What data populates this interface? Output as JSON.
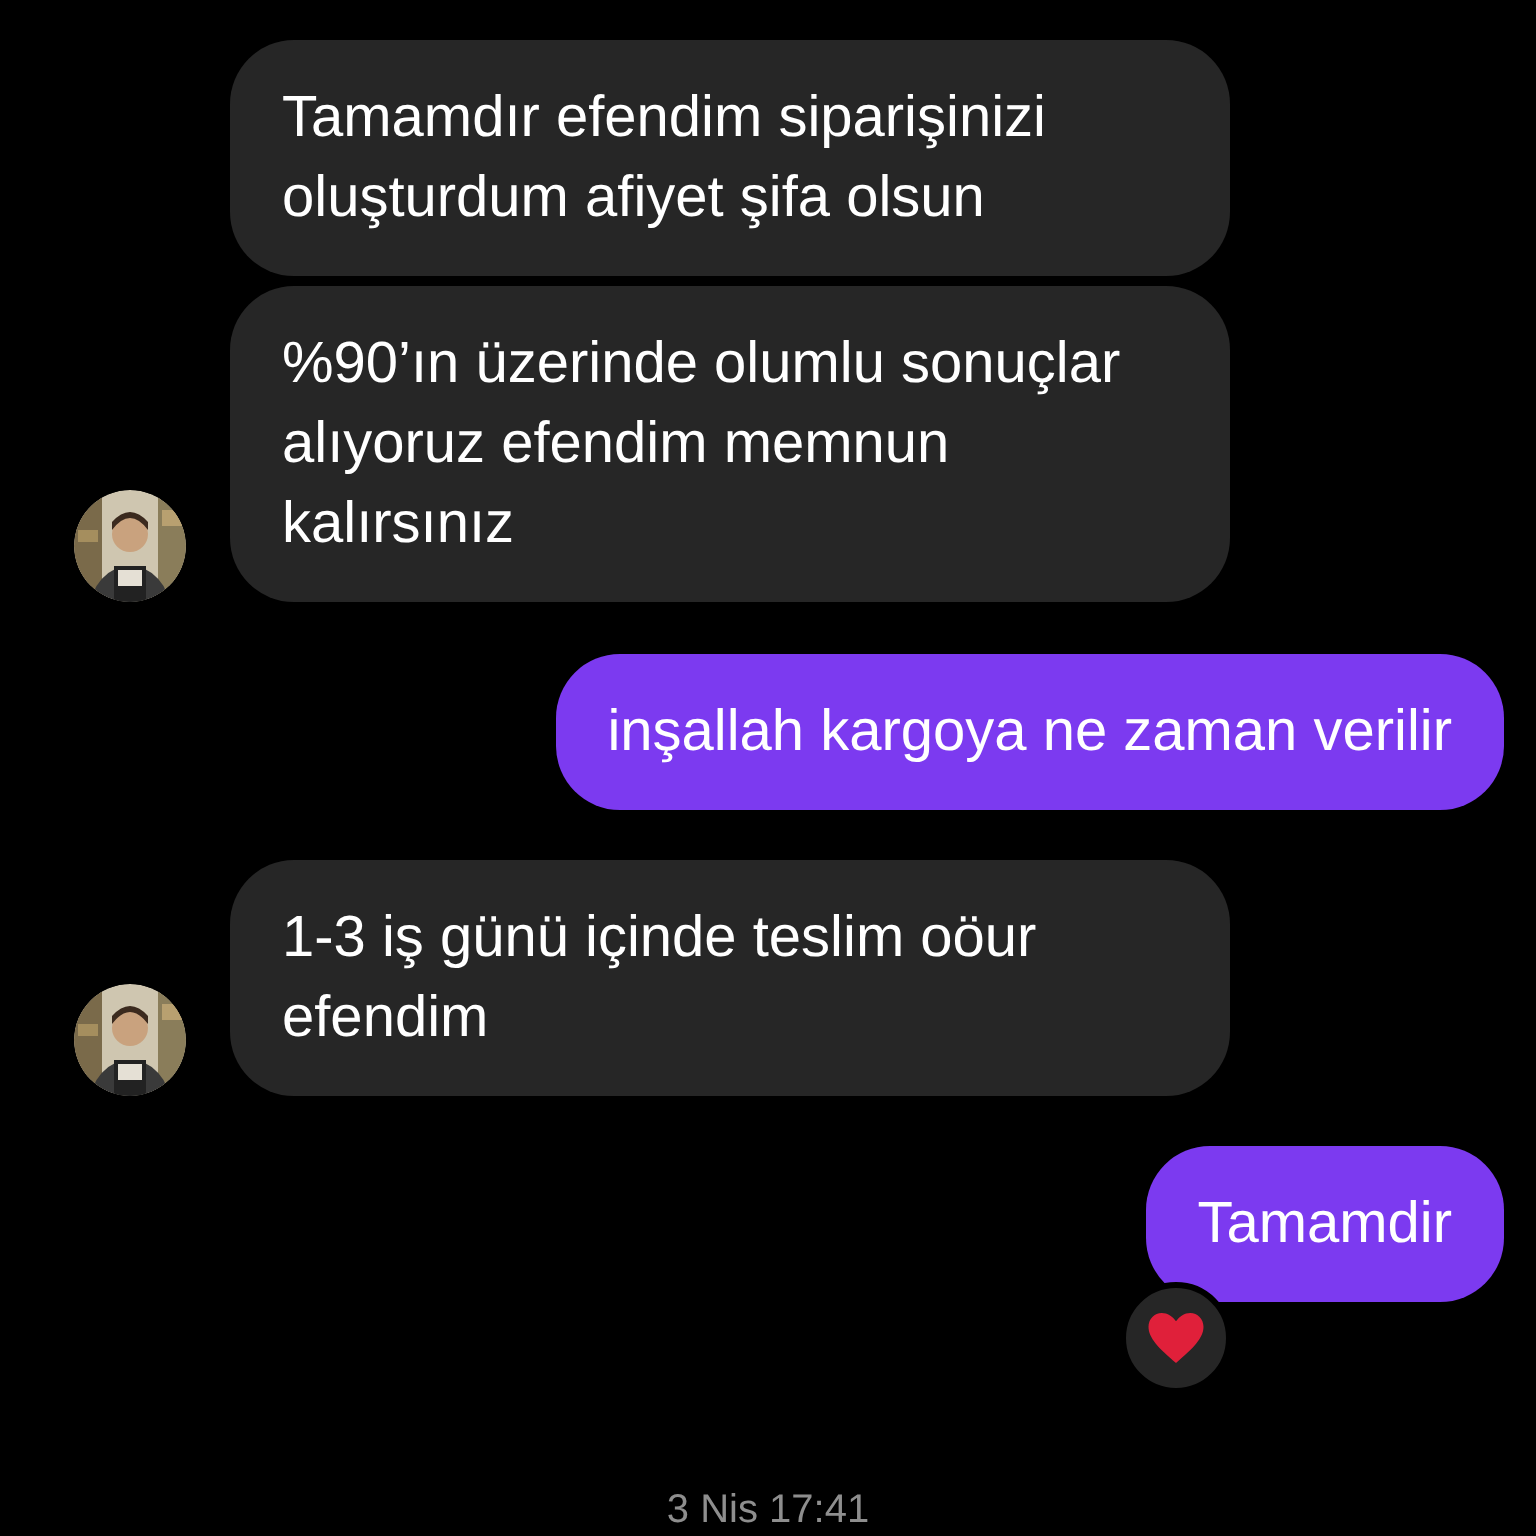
{
  "messages": [
    {
      "kind": "incoming",
      "avatar": false,
      "text": "Tamamdır efendim siparişinizi oluşturdum afiyet şifa olsun"
    },
    {
      "kind": "incoming",
      "avatar": true,
      "text": "%90’ın üzerinde olumlu sonuçlar alıyoruz efendim memnun kalırsınız"
    },
    {
      "kind": "outgoing",
      "text": "inşallah kargoya ne zaman verilir"
    },
    {
      "kind": "incoming",
      "avatar": true,
      "text": "1-3 iş günü içinde teslim oöur efendim"
    },
    {
      "kind": "outgoing",
      "text": "Tamamdir",
      "reacted": true
    }
  ],
  "timestamp": "3 Nis 17:41"
}
